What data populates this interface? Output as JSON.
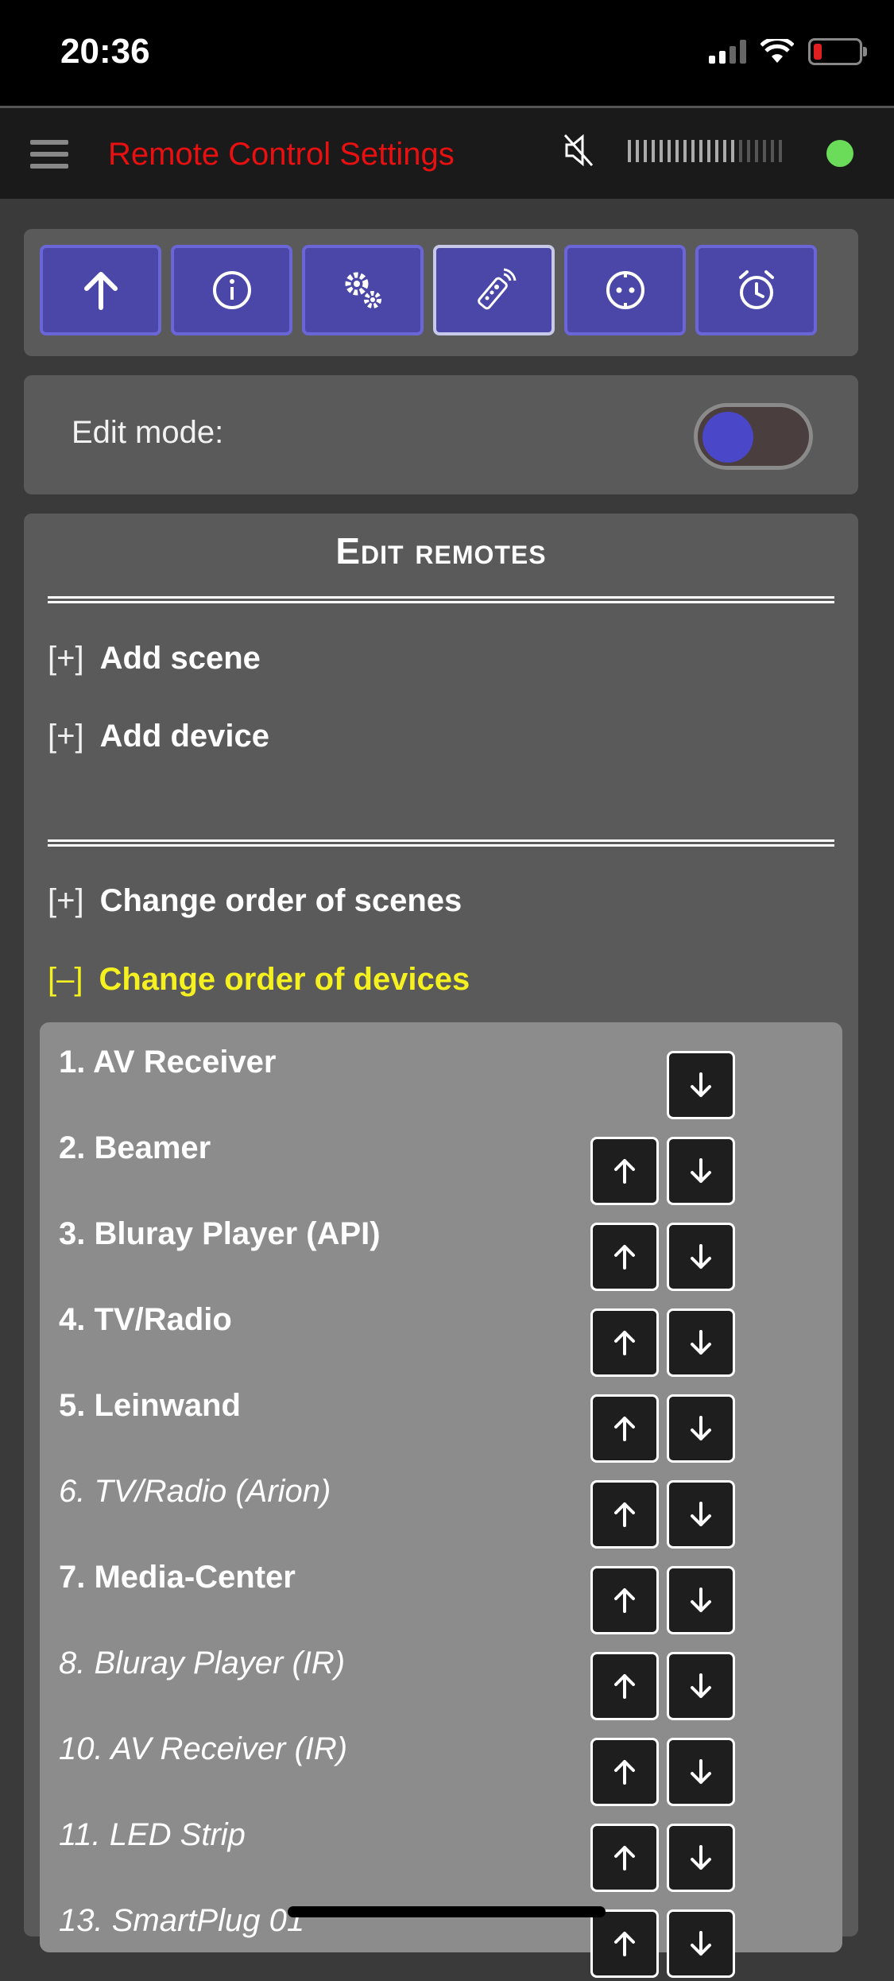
{
  "status_bar": {
    "time": "20:36",
    "battery_level": "low",
    "icons": [
      "signal-icon",
      "wifi-icon",
      "battery-icon"
    ]
  },
  "app_bar": {
    "title": "Remote Control Settings",
    "title_color": "#e81010",
    "connection_status_color": "#6bdc5a",
    "icons": [
      "menu-icon",
      "mute-icon",
      "volume-level-icon",
      "connection-status-icon"
    ]
  },
  "nav": {
    "buttons": [
      {
        "icon": "arrow-up-icon"
      },
      {
        "icon": "info-icon"
      },
      {
        "icon": "settings-gears-icon"
      },
      {
        "icon": "remote-control-icon",
        "active": true
      },
      {
        "icon": "plug-icon"
      },
      {
        "icon": "alarm-clock-icon"
      }
    ],
    "accent_color": "#4a47a8"
  },
  "edit_mode": {
    "label": "Edit mode:",
    "enabled": true
  },
  "edit_remotes": {
    "title": "Edit remotes",
    "add_scene": {
      "bracket": "[+]",
      "label": "Add scene"
    },
    "add_device": {
      "bracket": "[+]",
      "label": "Add device"
    },
    "order_scenes": {
      "bracket": "[+]",
      "label": "Change order of scenes"
    },
    "order_devices": {
      "bracket": "[–]",
      "label": "Change order of devices"
    },
    "devices": [
      {
        "label": "1. AV Receiver",
        "style": "bold",
        "up": false,
        "down": true
      },
      {
        "label": "2. Beamer",
        "style": "bold",
        "up": true,
        "down": true
      },
      {
        "label": "3. Bluray Player (API)",
        "style": "bold",
        "up": true,
        "down": true
      },
      {
        "label": "4. TV/Radio",
        "style": "bold",
        "up": true,
        "down": true
      },
      {
        "label": "5. Leinwand",
        "style": "bold",
        "up": true,
        "down": true
      },
      {
        "label": "6. TV/Radio (Arion)",
        "style": "italic",
        "up": true,
        "down": true
      },
      {
        "label": "7. Media-Center",
        "style": "bold",
        "up": true,
        "down": true
      },
      {
        "label": "8. Bluray Player (IR)",
        "style": "italic",
        "up": true,
        "down": true
      },
      {
        "label": "10. AV Receiver (IR)",
        "style": "italic",
        "up": true,
        "down": true
      },
      {
        "label": "11. LED Strip",
        "style": "italic",
        "up": true,
        "down": true
      },
      {
        "label": "13. SmartPlug 01",
        "style": "italic",
        "up": true,
        "down": true
      }
    ]
  }
}
